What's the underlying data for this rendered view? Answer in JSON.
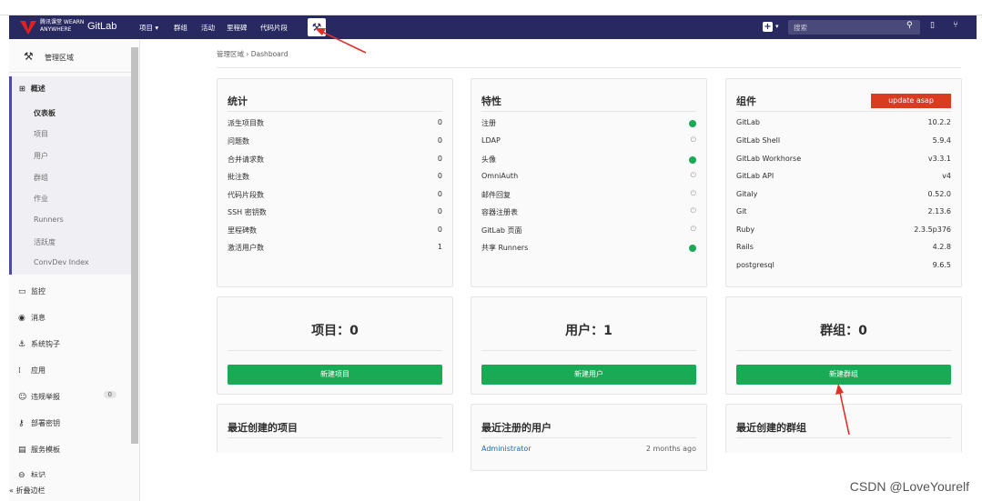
{
  "topbar": {
    "logo_text": "腾讯课堂 WEARN ANYWHERE",
    "brand": "GitLab",
    "nav": [
      "项目 ▾",
      "群组",
      "活动",
      "里程碑",
      "代码片段"
    ],
    "search_placeholder": "搜索",
    "bg_color": "#292961"
  },
  "sidebar": {
    "header": "管理区域",
    "overview_label": "概述",
    "overview_items": [
      "仪表板",
      "项目",
      "用户",
      "群组",
      "作业",
      "Runners",
      "活跃度",
      "ConvDev Index"
    ],
    "items": [
      {
        "icon": "monitor-icon",
        "label": "监控"
      },
      {
        "icon": "broadcast-icon",
        "label": "消息"
      },
      {
        "icon": "anchor-icon",
        "label": "系统钩子"
      },
      {
        "icon": "apps-icon",
        "label": "应用"
      },
      {
        "icon": "abuse-icon",
        "label": "违规举报",
        "badge": "0"
      },
      {
        "icon": "key-icon",
        "label": "部署密钥"
      },
      {
        "icon": "template-icon",
        "label": "服务模板"
      },
      {
        "icon": "label-icon",
        "label": "标记"
      }
    ],
    "collapse_label": "折叠边栏"
  },
  "breadcrumb": {
    "parent": "管理区域",
    "current": "Dashboard"
  },
  "stats": {
    "title": "统计",
    "rows": [
      {
        "k": "派生项目数",
        "v": "0"
      },
      {
        "k": "问题数",
        "v": "0"
      },
      {
        "k": "合并请求数",
        "v": "0"
      },
      {
        "k": "批注数",
        "v": "0"
      },
      {
        "k": "代码片段数",
        "v": "0"
      },
      {
        "k": "SSH 密钥数",
        "v": "0"
      },
      {
        "k": "里程碑数",
        "v": "0"
      },
      {
        "k": "激活用户数",
        "v": "1"
      }
    ]
  },
  "features": {
    "title": "特性",
    "rows": [
      {
        "k": "注册",
        "on": true
      },
      {
        "k": "LDAP",
        "on": false
      },
      {
        "k": "头像",
        "on": true
      },
      {
        "k": "OmniAuth",
        "on": false
      },
      {
        "k": "邮件回复",
        "on": false
      },
      {
        "k": "容器注册表",
        "on": false
      },
      {
        "k": "GitLab 页面",
        "on": false
      },
      {
        "k": "共享 Runners",
        "on": true
      }
    ]
  },
  "components": {
    "title": "组件",
    "update_label": "update asap",
    "rows": [
      {
        "k": "GitLab",
        "v": "10.2.2"
      },
      {
        "k": "GitLab Shell",
        "v": "5.9.4"
      },
      {
        "k": "GitLab Workhorse",
        "v": "v3.3.1"
      },
      {
        "k": "GitLab API",
        "v": "v4"
      },
      {
        "k": "Gitaly",
        "v": "0.52.0"
      },
      {
        "k": "Git",
        "v": "2.13.6"
      },
      {
        "k": "Ruby",
        "v": "2.3.5p376"
      },
      {
        "k": "Rails",
        "v": "4.2.8"
      },
      {
        "k": "postgresql",
        "v": "9.6.5"
      }
    ]
  },
  "counts": [
    {
      "title": "项目：0",
      "button": "新建项目"
    },
    {
      "title": "用户：1",
      "button": "新建用户"
    },
    {
      "title": "群组：0",
      "button": "新建群组"
    }
  ],
  "recent": [
    {
      "title": "最近创建的项目"
    },
    {
      "title": "最近注册的用户",
      "row": {
        "k": "Administrator",
        "v": "2 months ago"
      }
    },
    {
      "title": "最近创建的群组"
    }
  ],
  "watermark": "CSDN @LoveYourelf"
}
